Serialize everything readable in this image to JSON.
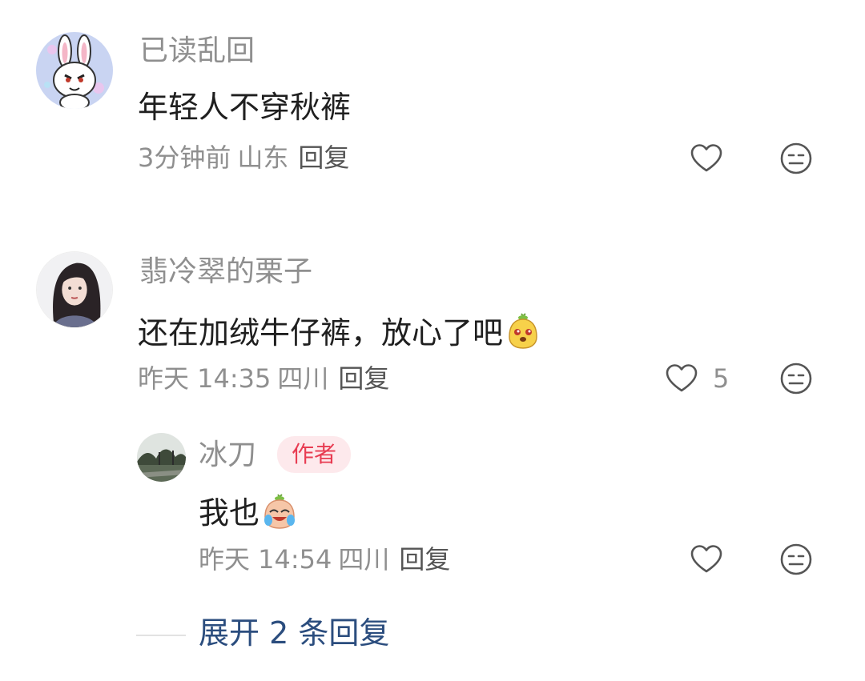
{
  "comments": [
    {
      "username": "已读乱回",
      "text": "年轻人不穿秋裤",
      "time": "3分钟前",
      "location": "山东",
      "reply_label": "回复",
      "avatar_icon": "bunny-avatar"
    },
    {
      "username": "翡冷翠的栗子",
      "text": "还在加绒牛仔裤，放心了吧",
      "emoji": "smiling-mango-emoji",
      "time": "昨天 14:35",
      "location": "四川",
      "reply_label": "回复",
      "like_count": "5",
      "avatar_icon": "girl-portrait-avatar",
      "replies": [
        {
          "username": "冰刀",
          "badge": "作者",
          "text": "我也",
          "emoji": "crying-laughing-emoji",
          "time": "昨天 14:54",
          "location": "四川",
          "reply_label": "回复",
          "avatar_icon": "landscape-avatar"
        }
      ]
    }
  ],
  "expand_replies": "展开 2 条回复",
  "colors": {
    "username": "#8f8f8f",
    "text": "#1f1f1f",
    "badge_bg": "#fde9ec",
    "badge_text": "#e83c52",
    "expand_link": "#2b4d7e"
  }
}
